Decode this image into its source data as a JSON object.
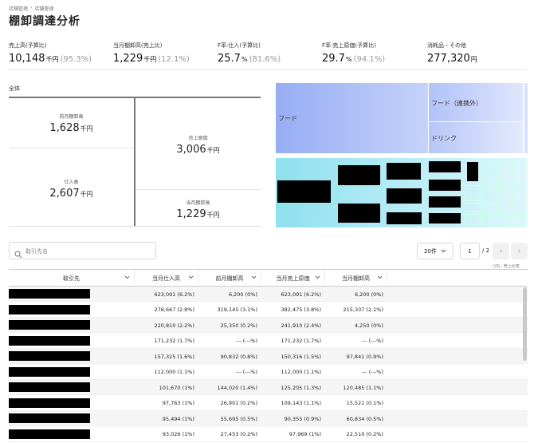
{
  "breadcrumb": [
    "店舗管理",
    "›",
    "店舗管理"
  ],
  "title": "棚卸調達分析",
  "kpis": [
    {
      "label": "売上高(予算比)",
      "value": "10,148",
      "unit": "千円",
      "sub": "(95.3%)"
    },
    {
      "label": "当月棚卸高(売上比)",
      "value": "1,229",
      "unit": "千円",
      "sub": "(12.1%)"
    },
    {
      "label": "F率:仕入(予算比)",
      "value": "25.7",
      "unit": "%",
      "sub": "(81.6%)"
    },
    {
      "label": "F率:売上原価(予算比)",
      "value": "29.7",
      "unit": "%",
      "sub": "(94.1%)"
    },
    {
      "label": "消耗品・その他",
      "value": "277,320",
      "unit": "円",
      "sub": ""
    }
  ],
  "overall": {
    "label": "全体",
    "prev_stock": {
      "label": "前月棚卸高",
      "value": "1,628",
      "unit": "千円"
    },
    "purchase": {
      "label": "仕入高",
      "value": "2,607",
      "unit": "千円"
    },
    "cost": {
      "label": "売上原価",
      "value": "3,006",
      "unit": "千円"
    },
    "cur_stock": {
      "label": "当月棚卸高",
      "value": "1,229",
      "unit": "千円"
    }
  },
  "treemap": {
    "food": "フード",
    "food_partner": "フード（連携外）",
    "drink": "ドリンク"
  },
  "search": {
    "placeholder": "取引先名",
    "value": ""
  },
  "pager": {
    "page_size": "20件",
    "page": "1",
    "total": "/ 2",
    "prev": "‹",
    "next": "›",
    "note": "()内・売上比率"
  },
  "table": {
    "headers": [
      "取引先",
      "当月仕入高",
      "前月棚卸高",
      "当月売上原価",
      "当月棚卸高"
    ],
    "rows": [
      [
        "623,091 (6.2%)",
        "6,200 (0%)",
        "623,091 (6.2%)",
        "6,200 (0%)"
      ],
      [
        "278,667 (2.8%)",
        "319,145 (3.1%)",
        "382,475 (3.8%)",
        "215,337 (2.1%)"
      ],
      [
        "220,810 (2.2%)",
        "25,350 (0.2%)",
        "241,910 (2.4%)",
        "4,250 (0%)"
      ],
      [
        "171,232 (1.7%)",
        "--- (---%)",
        "171,232 (1.7%)",
        "--- (---%)"
      ],
      [
        "157,325 (1.6%)",
        "90,832 (0.8%)",
        "150,316 (1.5%)",
        "97,841 (0.9%)"
      ],
      [
        "112,000 (1.1%)",
        "--- (---%)",
        "112,000 (1.1%)",
        "--- (---%)"
      ],
      [
        "101,670 (1%)",
        "144,020 (1.4%)",
        "125,205 (1.3%)",
        "120,485 (1.1%)"
      ],
      [
        "97,763 (1%)",
        "26,901 (0.2%)",
        "109,143 (1.1%)",
        "15,521 (0.1%)"
      ],
      [
        "95,494 (1%)",
        "55,695 (0.5%)",
        "90,355 (0.9%)",
        "60,834 (0.5%)"
      ],
      [
        "93,026 (1%)",
        "27,453 (0.2%)",
        "97,969 (1%)",
        "22,510 (0.2%)"
      ]
    ]
  },
  "colors": {
    "treemap_top_from": "#9bb0f5",
    "treemap_top_to": "#dfe6fc",
    "treemap_bottom_from": "#8fe3f0",
    "treemap_bottom_to": "#e2f8fb"
  }
}
